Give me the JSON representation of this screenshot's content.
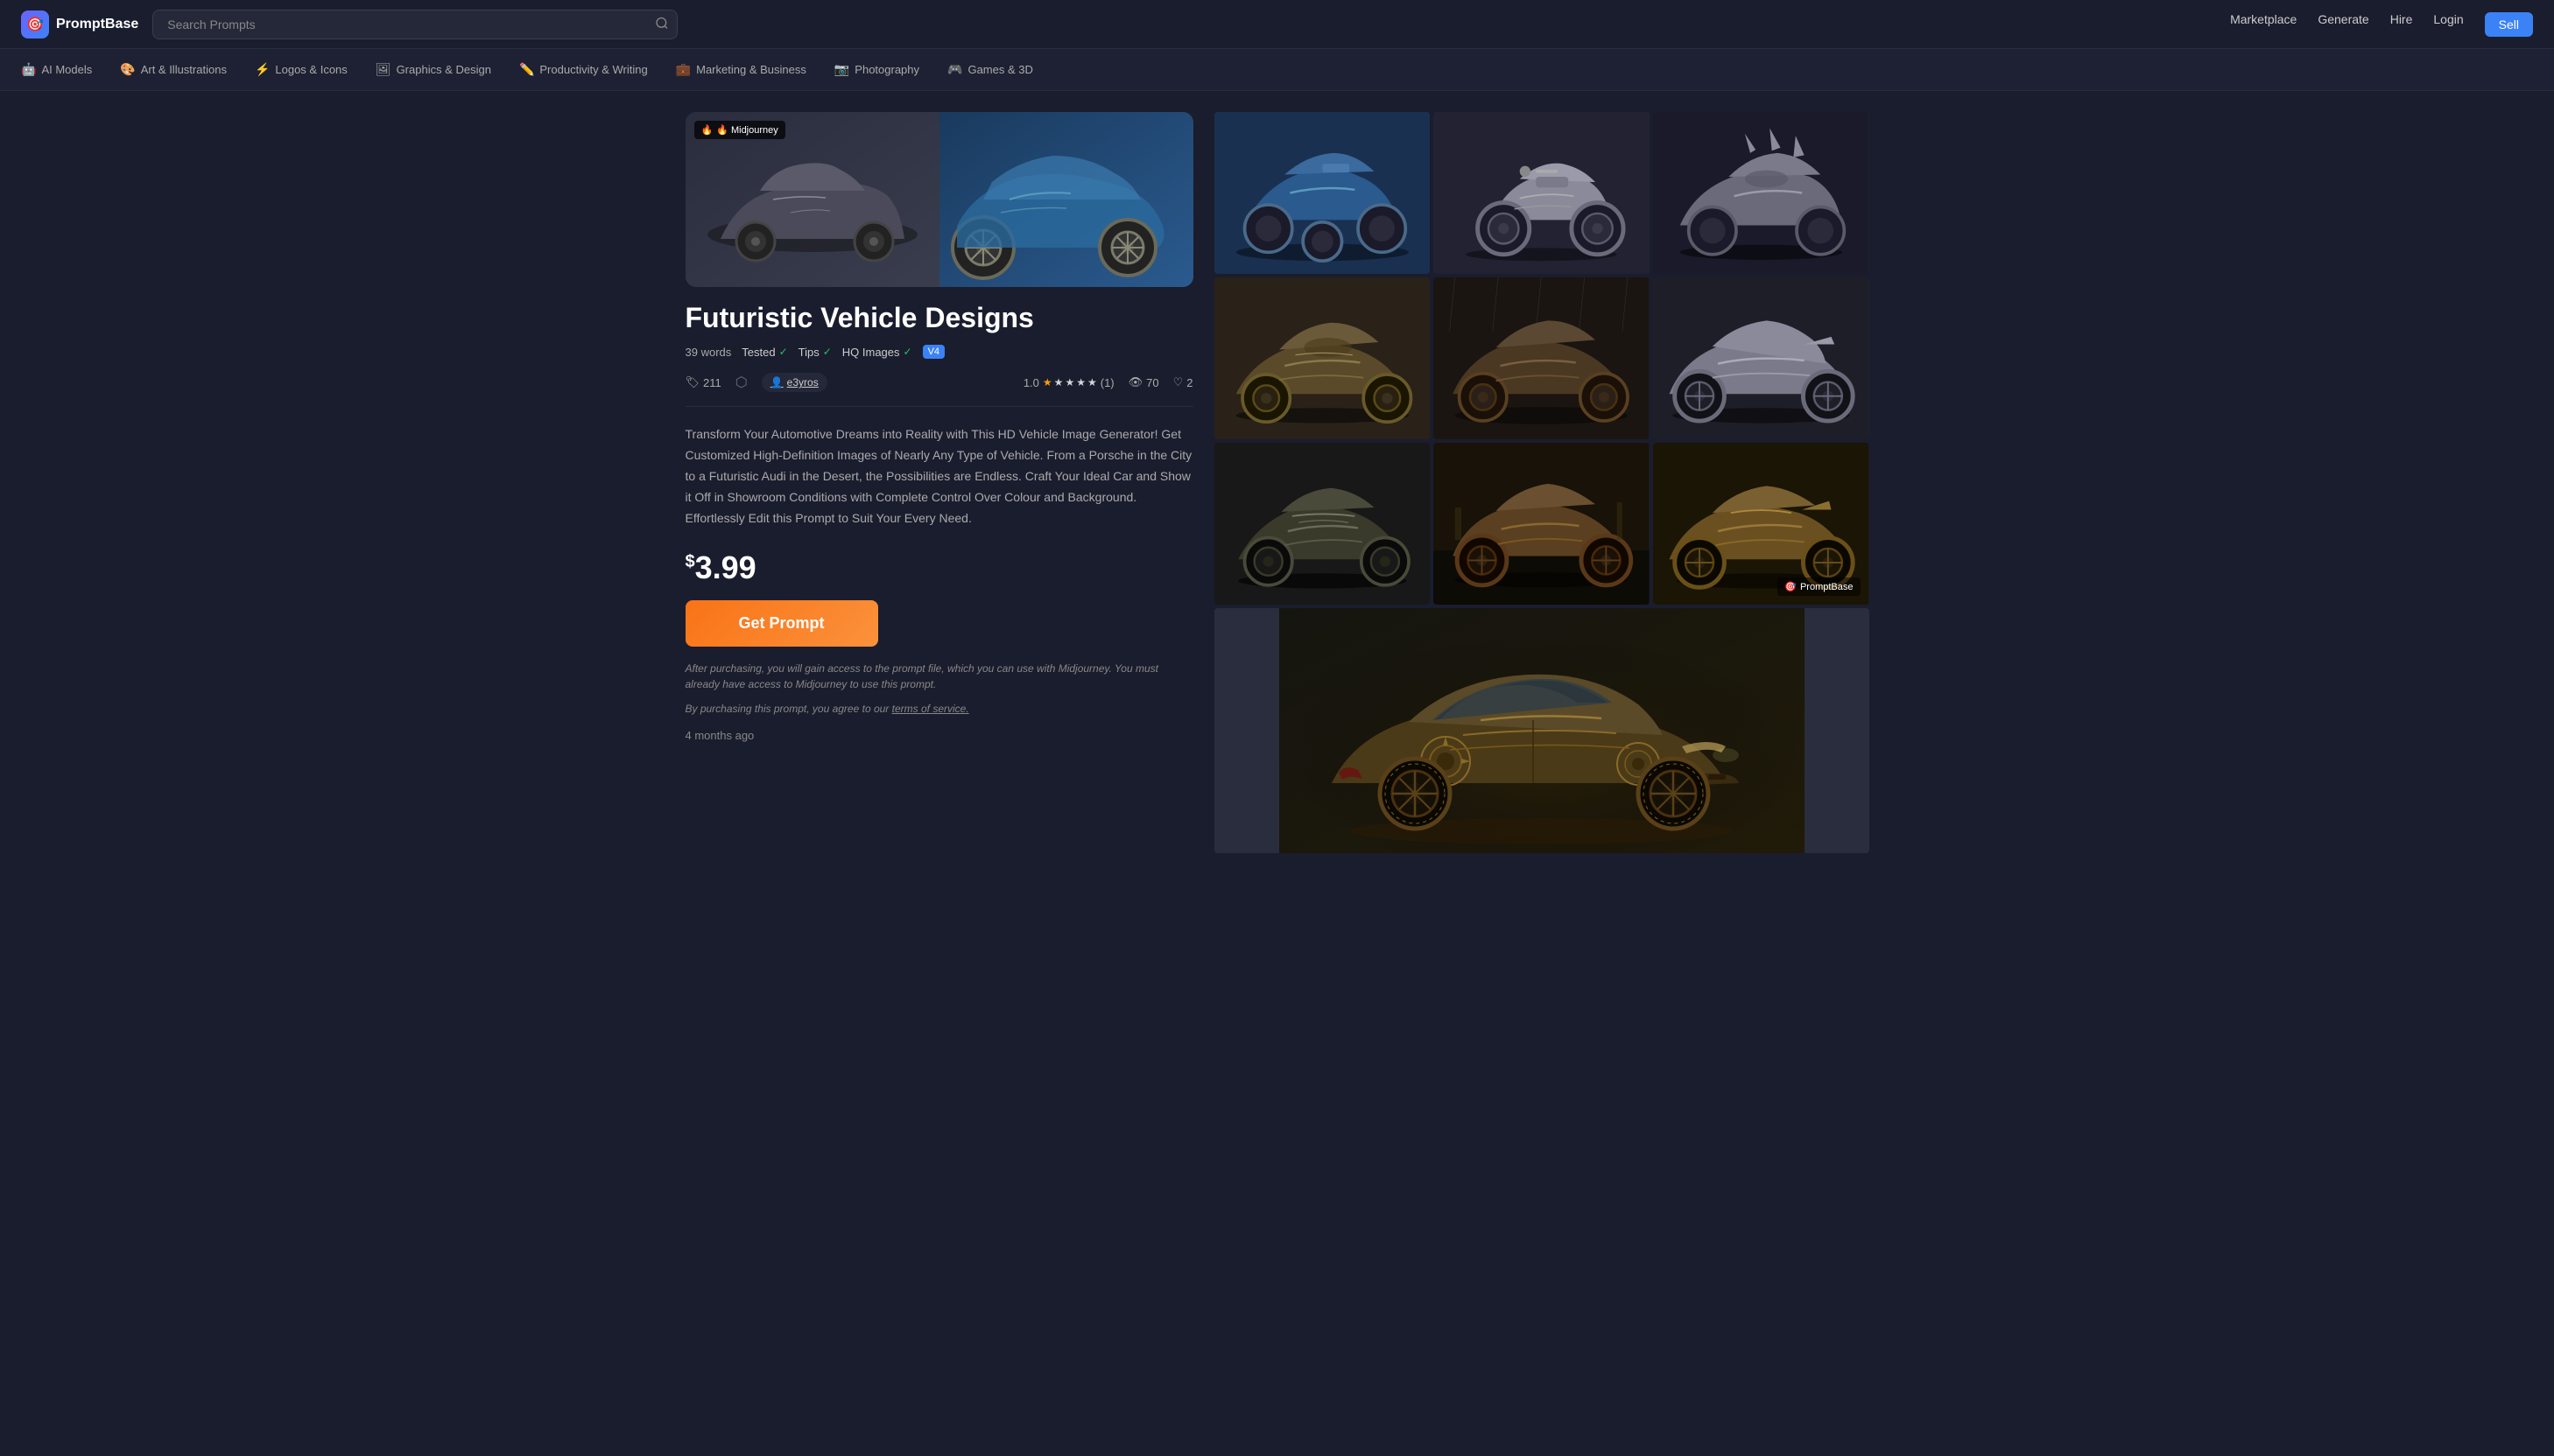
{
  "header": {
    "logo_text": "PromptBase",
    "search_placeholder": "Search Prompts",
    "nav": {
      "marketplace": "Marketplace",
      "generate": "Generate",
      "hire": "Hire",
      "login": "Login",
      "sell": "Sell"
    }
  },
  "subnav": {
    "items": [
      {
        "id": "ai-models",
        "icon": "🤖",
        "label": "AI Models"
      },
      {
        "id": "art-illustrations",
        "icon": "🎨",
        "label": "Art & Illustrations"
      },
      {
        "id": "logos-icons",
        "icon": "⚡",
        "label": "Logos & Icons"
      },
      {
        "id": "graphics-design",
        "icon": "🖼",
        "label": "Graphics & Design"
      },
      {
        "id": "productivity-writing",
        "icon": "✏️",
        "label": "Productivity & Writing"
      },
      {
        "id": "marketing-business",
        "icon": "💼",
        "label": "Marketing & Business"
      },
      {
        "id": "photography",
        "icon": "📷",
        "label": "Photography"
      },
      {
        "id": "games-3d",
        "icon": "🎮",
        "label": "Games & 3D"
      }
    ]
  },
  "product": {
    "badge": "🔥 Midjourney",
    "title": "Futuristic Vehicle Designs",
    "word_count": "39 words",
    "tested_label": "Tested",
    "tips_label": "Tips",
    "hq_images_label": "HQ Images",
    "v4_label": "V4",
    "tag_count": "211",
    "author": "e3yros",
    "rating": "1.0",
    "review_count": "(1)",
    "views": "70",
    "likes": "2",
    "description": "Transform Your Automotive Dreams into Reality with This HD Vehicle Image Generator! Get Customized High-Definition Images of Nearly Any Type of Vehicle. From a Porsche in the City to a Futuristic Audi in the Desert, the Possibilities are Endless. Craft Your Ideal Car and Show it Off in Showroom Conditions with Complete Control Over Colour and Background. Effortlessly Edit this Prompt to Suit Your Every Need.",
    "price": "3.99",
    "currency": "$",
    "cta_label": "Get Prompt",
    "disclaimer": "After purchasing, you will gain access to the prompt file, which you can use with Midjourney. You must already have access to Midjourney to use this prompt.",
    "tos_text": "By purchasing this prompt, you agree to our ",
    "tos_link": "terms of service.",
    "timestamp": "4 months ago"
  },
  "gallery": {
    "watermark": "PromptBase",
    "images": [
      {
        "id": "img1",
        "color": "#3a4a6e",
        "accent": "#4a8ab0"
      },
      {
        "id": "img2",
        "color": "#4a4a5e",
        "accent": "#8a8a9e"
      },
      {
        "id": "img3",
        "color": "#2a2a3e",
        "accent": "#6a6a7e"
      },
      {
        "id": "img4",
        "color": "#3a3a4e",
        "accent": "#7a7a8e"
      },
      {
        "id": "img5",
        "color": "#2a3a4e",
        "accent": "#5a6a7e"
      },
      {
        "id": "img6",
        "color": "#3a2a2e",
        "accent": "#8a6a6e"
      },
      {
        "id": "img7",
        "color": "#2a3a2e",
        "accent": "#5a7a5e"
      },
      {
        "id": "img8",
        "color": "#3a3a2e",
        "accent": "#7a7a5e"
      },
      {
        "id": "img9",
        "color": "#2a2a4e",
        "accent": "#5a5a8e"
      }
    ]
  }
}
